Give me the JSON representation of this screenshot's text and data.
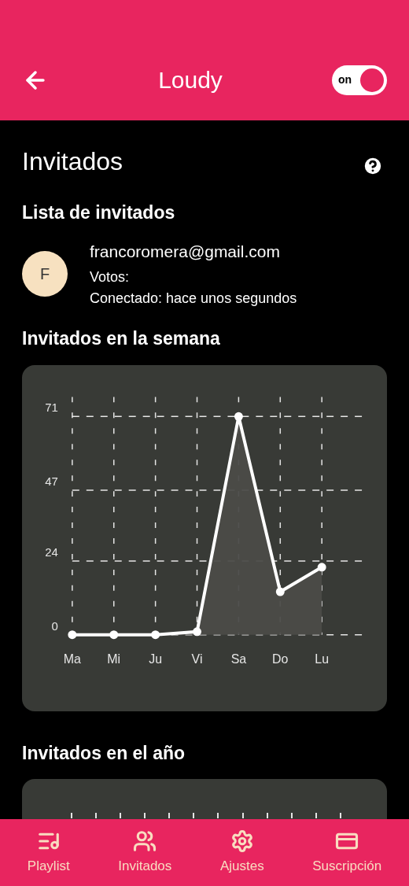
{
  "app_bar": {
    "title": "Loudy",
    "toggle": {
      "label": "on",
      "on": true
    }
  },
  "page_title": "Invitados",
  "guest_list": {
    "title": "Lista de invitados",
    "guests": [
      {
        "initial": "F",
        "email": "francoromera@gmail.com",
        "votes": "Votos:",
        "connected": "Conectado: hace unos segundos"
      }
    ]
  },
  "week_section": {
    "title": "Invitados en la semana",
    "chart_data": {
      "type": "area",
      "categories": [
        "Ma",
        "Mi",
        "Ju",
        "Vi",
        "Sa",
        "Do",
        "Lu"
      ],
      "series": [
        {
          "color": "#ffffff",
          "values": [
            0,
            0,
            0,
            1,
            71,
            14,
            22
          ]
        }
      ],
      "ylim": [
        0,
        71
      ],
      "yticks": [
        0,
        24,
        47,
        71
      ],
      "grid": true
    }
  },
  "year_section": {
    "title": "Invitados en el año"
  },
  "bottom_nav": [
    {
      "label": "Playlist"
    },
    {
      "label": "Invitados"
    },
    {
      "label": "Ajustes"
    },
    {
      "label": "Suscripción"
    }
  ]
}
